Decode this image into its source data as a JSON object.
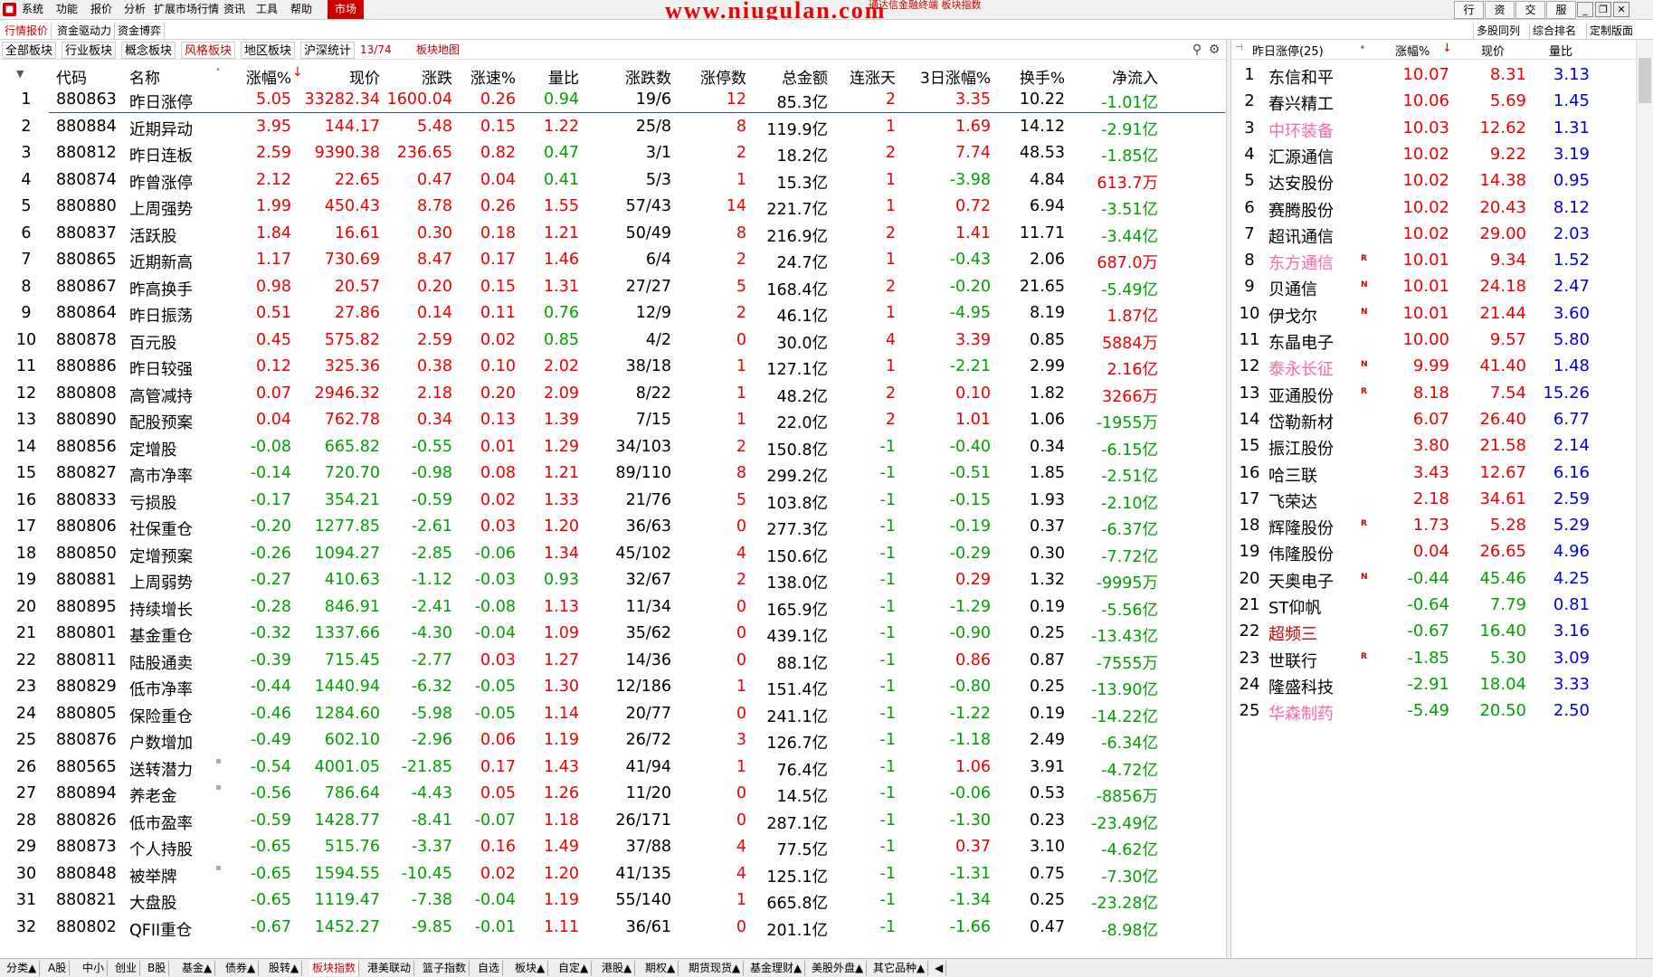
{
  "menu": {
    "items": [
      "系统",
      "功能",
      "报价",
      "分析",
      "扩展市场行情",
      "资讯",
      "工具",
      "帮助"
    ],
    "active": "市场",
    "watermark": "www.niugulan.com",
    "watermark_sub": "通达信金融终端 板块指数",
    "right_buttons": [
      "行情",
      "资讯",
      "交易",
      "服务"
    ]
  },
  "subtabs": {
    "left": [
      "行情报价",
      "资金驱动力",
      "资金博弈"
    ],
    "right": [
      "多股同列",
      "综合排名",
      "定制版面"
    ]
  },
  "categories": {
    "items": [
      "全部板块",
      "行业板块",
      "概念板块",
      "风格板块",
      "地区板块",
      "沪深统计"
    ],
    "active_index": 3,
    "count": "13/74",
    "map_label": "板块地图"
  },
  "table": {
    "headers": [
      "代码",
      "名称",
      "涨幅%",
      "现价",
      "涨跌",
      "涨速%",
      "量比",
      "涨跌数",
      "涨停数",
      "总金额",
      "连涨天",
      "3日涨幅%",
      "换手%",
      "净流入"
    ],
    "rows": [
      [
        "1",
        "880863",
        "昨日涨停",
        "5.05",
        "33282.34",
        "1600.04",
        "0.26",
        "0.94",
        "19/6",
        "12",
        "85.3亿",
        "2",
        "3.35",
        "10.22",
        "-1.01亿"
      ],
      [
        "2",
        "880884",
        "近期异动",
        "3.95",
        "144.17",
        "5.48",
        "0.15",
        "1.22",
        "25/8",
        "8",
        "119.9亿",
        "1",
        "1.69",
        "14.12",
        "-2.91亿"
      ],
      [
        "3",
        "880812",
        "昨日连板",
        "2.59",
        "9390.38",
        "236.65",
        "0.82",
        "0.47",
        "3/1",
        "2",
        "18.2亿",
        "2",
        "7.74",
        "48.53",
        "-1.85亿"
      ],
      [
        "4",
        "880874",
        "昨曾涨停",
        "2.12",
        "22.65",
        "0.47",
        "0.04",
        "0.41",
        "5/3",
        "1",
        "15.3亿",
        "1",
        "-3.98",
        "4.84",
        "613.7万"
      ],
      [
        "5",
        "880880",
        "上周强势",
        "1.99",
        "450.43",
        "8.78",
        "0.26",
        "1.55",
        "57/43",
        "14",
        "221.7亿",
        "1",
        "0.72",
        "6.94",
        "-3.51亿"
      ],
      [
        "6",
        "880837",
        "活跃股",
        "1.84",
        "16.61",
        "0.30",
        "0.18",
        "1.21",
        "50/49",
        "8",
        "216.9亿",
        "2",
        "1.41",
        "11.71",
        "-3.44亿"
      ],
      [
        "7",
        "880865",
        "近期新高",
        "1.17",
        "730.69",
        "8.47",
        "0.17",
        "1.46",
        "6/4",
        "2",
        "24.7亿",
        "1",
        "-0.43",
        "2.06",
        "687.0万"
      ],
      [
        "8",
        "880867",
        "昨高换手",
        "0.98",
        "20.57",
        "0.20",
        "0.15",
        "1.31",
        "27/27",
        "5",
        "168.4亿",
        "2",
        "-0.20",
        "21.65",
        "-5.49亿"
      ],
      [
        "9",
        "880864",
        "昨日振荡",
        "0.51",
        "27.86",
        "0.14",
        "0.11",
        "0.76",
        "12/9",
        "2",
        "46.1亿",
        "1",
        "-4.95",
        "8.19",
        "1.87亿"
      ],
      [
        "10",
        "880878",
        "百元股",
        "0.45",
        "575.82",
        "2.59",
        "0.02",
        "0.85",
        "4/2",
        "0",
        "30.0亿",
        "4",
        "3.39",
        "0.85",
        "5884万"
      ],
      [
        "11",
        "880886",
        "昨日较强",
        "0.12",
        "325.36",
        "0.38",
        "0.10",
        "2.02",
        "38/18",
        "1",
        "127.1亿",
        "1",
        "-2.21",
        "2.99",
        "2.16亿"
      ],
      [
        "12",
        "880808",
        "高管减持",
        "0.07",
        "2946.32",
        "2.18",
        "0.20",
        "2.09",
        "8/22",
        "1",
        "48.2亿",
        "2",
        "0.10",
        "1.82",
        "3266万"
      ],
      [
        "13",
        "880890",
        "配股预案",
        "0.04",
        "762.78",
        "0.34",
        "0.13",
        "1.39",
        "7/15",
        "1",
        "22.0亿",
        "2",
        "1.01",
        "1.06",
        "-1955万"
      ],
      [
        "14",
        "880856",
        "定增股",
        "-0.08",
        "665.82",
        "-0.55",
        "0.01",
        "1.29",
        "34/103",
        "2",
        "150.8亿",
        "-1",
        "-0.40",
        "0.34",
        "-6.15亿"
      ],
      [
        "15",
        "880827",
        "高市净率",
        "-0.14",
        "720.70",
        "-0.98",
        "0.08",
        "1.21",
        "89/110",
        "8",
        "299.2亿",
        "-1",
        "-0.51",
        "1.85",
        "-2.51亿"
      ],
      [
        "16",
        "880833",
        "亏损股",
        "-0.17",
        "354.21",
        "-0.59",
        "0.02",
        "1.33",
        "21/76",
        "5",
        "103.8亿",
        "-1",
        "-0.15",
        "1.93",
        "-2.10亿"
      ],
      [
        "17",
        "880806",
        "社保重仓",
        "-0.20",
        "1277.85",
        "-2.61",
        "0.03",
        "1.20",
        "36/63",
        "0",
        "277.3亿",
        "-1",
        "-0.19",
        "0.37",
        "-6.37亿"
      ],
      [
        "18",
        "880850",
        "定增预案",
        "-0.26",
        "1094.27",
        "-2.85",
        "-0.06",
        "1.34",
        "45/102",
        "4",
        "150.6亿",
        "-1",
        "-0.29",
        "0.30",
        "-7.72亿"
      ],
      [
        "19",
        "880881",
        "上周弱势",
        "-0.27",
        "410.63",
        "-1.12",
        "-0.03",
        "0.93",
        "32/67",
        "2",
        "138.0亿",
        "-1",
        "0.29",
        "1.32",
        "-9995万"
      ],
      [
        "20",
        "880895",
        "持续增长",
        "-0.28",
        "846.91",
        "-2.41",
        "-0.08",
        "1.13",
        "11/34",
        "0",
        "165.9亿",
        "-1",
        "-1.29",
        "0.19",
        "-5.56亿"
      ],
      [
        "21",
        "880801",
        "基金重仓",
        "-0.32",
        "1337.66",
        "-4.30",
        "-0.04",
        "1.09",
        "35/62",
        "0",
        "439.1亿",
        "-1",
        "-0.90",
        "0.25",
        "-13.43亿"
      ],
      [
        "22",
        "880811",
        "陆股通卖",
        "-0.39",
        "715.45",
        "-2.77",
        "0.03",
        "1.27",
        "14/36",
        "0",
        "88.1亿",
        "-1",
        "0.86",
        "0.87",
        "-7555万"
      ],
      [
        "23",
        "880829",
        "低市净率",
        "-0.44",
        "1440.94",
        "-6.32",
        "-0.05",
        "1.30",
        "12/186",
        "1",
        "151.4亿",
        "-1",
        "-0.80",
        "0.25",
        "-13.90亿"
      ],
      [
        "24",
        "880805",
        "保险重仓",
        "-0.46",
        "1284.60",
        "-5.98",
        "-0.05",
        "1.14",
        "20/77",
        "0",
        "241.1亿",
        "-1",
        "-1.22",
        "0.19",
        "-14.22亿"
      ],
      [
        "25",
        "880876",
        "户数增加",
        "-0.49",
        "602.10",
        "-2.96",
        "0.06",
        "1.19",
        "26/72",
        "3",
        "126.7亿",
        "-1",
        "-1.18",
        "2.49",
        "-6.34亿"
      ],
      [
        "26",
        "880565",
        "送转潜力",
        "-0.54",
        "4001.05",
        "-21.85",
        "0.17",
        "1.43",
        "41/94",
        "1",
        "76.4亿",
        "-1",
        "1.06",
        "3.91",
        "-4.72亿"
      ],
      [
        "27",
        "880894",
        "养老金",
        "-0.56",
        "786.64",
        "-4.43",
        "0.05",
        "1.26",
        "11/20",
        "0",
        "14.5亿",
        "-1",
        "-0.06",
        "0.53",
        "-8856万"
      ],
      [
        "28",
        "880826",
        "低市盈率",
        "-0.59",
        "1428.77",
        "-8.41",
        "-0.07",
        "1.18",
        "26/171",
        "0",
        "287.1亿",
        "-1",
        "-1.30",
        "0.23",
        "-23.49亿"
      ],
      [
        "29",
        "880873",
        "个人持股",
        "-0.65",
        "515.76",
        "-3.37",
        "0.16",
        "1.49",
        "37/88",
        "4",
        "77.5亿",
        "-1",
        "0.37",
        "3.10",
        "-4.62亿"
      ],
      [
        "30",
        "880848",
        "被举牌",
        "-0.65",
        "1594.55",
        "-10.45",
        "0.02",
        "1.20",
        "41/135",
        "4",
        "125.1亿",
        "-1",
        "-1.31",
        "0.75",
        "-7.30亿"
      ],
      [
        "31",
        "880821",
        "大盘股",
        "-0.65",
        "1119.47",
        "-7.38",
        "-0.04",
        "1.19",
        "55/140",
        "1",
        "665.8亿",
        "-1",
        "-1.34",
        "0.25",
        "-23.28亿"
      ],
      [
        "32",
        "880802",
        "QFII重仓",
        "-0.67",
        "1452.27",
        "-9.85",
        "-0.01",
        "1.11",
        "36/61",
        "0",
        "201.1亿",
        "-1",
        "-1.66",
        "0.47",
        "-8.98亿"
      ]
    ]
  },
  "right_panel": {
    "title": "昨日涨停(25)",
    "headers": [
      "涨幅%",
      "现价",
      "量比"
    ],
    "rows": [
      [
        "1",
        "东信和平",
        "",
        "10.07",
        "8.31",
        "3.13",
        "blk"
      ],
      [
        "2",
        "春兴精工",
        "",
        "10.06",
        "5.69",
        "1.45",
        "blk"
      ],
      [
        "3",
        "中环装备",
        "",
        "10.03",
        "12.62",
        "1.31",
        "pink"
      ],
      [
        "4",
        "汇源通信",
        "",
        "10.02",
        "9.22",
        "3.19",
        "blk"
      ],
      [
        "5",
        "达安股份",
        "",
        "10.02",
        "14.38",
        "0.95",
        "blk"
      ],
      [
        "6",
        "赛腾股份",
        "",
        "10.02",
        "20.43",
        "8.12",
        "blk"
      ],
      [
        "7",
        "超讯通信",
        "",
        "10.02",
        "29.00",
        "2.03",
        "blk"
      ],
      [
        "8",
        "东方通信",
        "R",
        "10.01",
        "9.34",
        "1.52",
        "pink"
      ],
      [
        "9",
        "贝通信",
        "N",
        "10.01",
        "24.18",
        "2.47",
        "blk"
      ],
      [
        "10",
        "伊戈尔",
        "N",
        "10.01",
        "21.44",
        "3.60",
        "blk"
      ],
      [
        "11",
        "东晶电子",
        "",
        "10.00",
        "9.57",
        "5.80",
        "blk"
      ],
      [
        "12",
        "泰永长征",
        "N",
        "9.99",
        "41.40",
        "1.48",
        "pink"
      ],
      [
        "13",
        "亚通股份",
        "R",
        "8.18",
        "7.54",
        "15.26",
        "blk"
      ],
      [
        "14",
        "岱勒新材",
        "",
        "6.07",
        "26.40",
        "6.77",
        "blk"
      ],
      [
        "15",
        "振江股份",
        "",
        "3.80",
        "21.58",
        "2.14",
        "blk"
      ],
      [
        "16",
        "哈三联",
        "",
        "3.43",
        "12.67",
        "6.16",
        "blk"
      ],
      [
        "17",
        "飞荣达",
        "",
        "2.18",
        "34.61",
        "2.59",
        "blk"
      ],
      [
        "18",
        "辉隆股份",
        "R",
        "1.73",
        "5.28",
        "5.29",
        "blk"
      ],
      [
        "19",
        "伟隆股份",
        "",
        "0.04",
        "26.65",
        "4.96",
        "blk"
      ],
      [
        "20",
        "天奥电子",
        "N",
        "-0.44",
        "45.46",
        "4.25",
        "blk"
      ],
      [
        "21",
        "ST仰帆",
        "",
        "-0.64",
        "7.79",
        "0.81",
        "blk"
      ],
      [
        "22",
        "超频三",
        "",
        "-0.67",
        "16.40",
        "3.16",
        "darkred"
      ],
      [
        "23",
        "世联行",
        "R",
        "-1.85",
        "5.30",
        "3.09",
        "blk"
      ],
      [
        "24",
        "隆盛科技",
        "",
        "-2.91",
        "18.04",
        "3.33",
        "blk"
      ],
      [
        "25",
        "华森制药",
        "",
        "-5.49",
        "20.50",
        "2.50",
        "pink"
      ]
    ]
  },
  "bottom_tabs": {
    "items": [
      "分类▲",
      "A股",
      "中小",
      "创业",
      "B股",
      "基金▲",
      "债券▲",
      "股转▲",
      "板块指数",
      "港美联动",
      "篮子指数",
      "自选",
      "板块▲",
      "自定▲",
      "港股▲",
      "期权▲",
      "期货现货▲",
      "基金理财▲",
      "美股外盘▲",
      "其它品种▲"
    ],
    "active_index": 8
  },
  "colors": {
    "up": "#e00000",
    "down": "#00a000",
    "accent": "#cc0000",
    "selected_line": "#2a52be",
    "volume_ratio": "#0000e0"
  }
}
